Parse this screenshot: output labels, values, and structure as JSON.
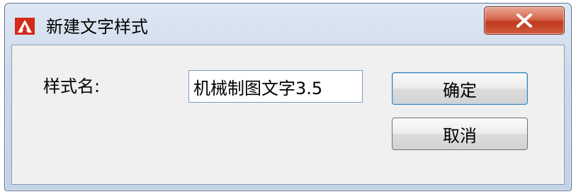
{
  "window": {
    "title": "新建文字样式",
    "icon": "autocad-logo-icon",
    "close_icon": "close-icon"
  },
  "form": {
    "style_name_label": "样式名:",
    "style_name_value": "机械制图文字3.5"
  },
  "buttons": {
    "ok_label": "确定",
    "cancel_label": "取消"
  },
  "colors": {
    "close_button": "#c8462b",
    "app_icon": "#d42a1a",
    "default_button_border": "#3c7fb1"
  }
}
